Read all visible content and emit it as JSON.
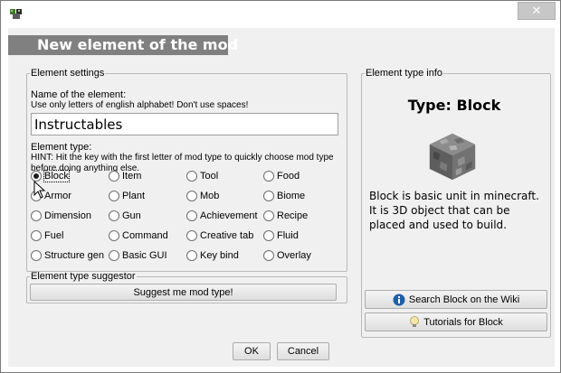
{
  "window": {
    "close_glyph": "✕"
  },
  "header": {
    "title": "New element of the mod"
  },
  "settings": {
    "legend": "Element settings",
    "name_label": "Name of the element:",
    "name_hint": "Use only letters of english alphabet! Don't use spaces!",
    "name_value": "Instructables",
    "type_label": "Element type:",
    "type_hint_1": "HINT: Hit the key with the first letter of mod type to quickly choose mod type",
    "type_hint_2": "before doing anything else.",
    "types": [
      [
        "Block",
        "Item",
        "Tool",
        "Food"
      ],
      [
        "Armor",
        "Plant",
        "Mob",
        "Biome"
      ],
      [
        "Dimension",
        "Gun",
        "Achievement",
        "Recipe"
      ],
      [
        "Fuel",
        "Command",
        "Creative tab",
        "Fluid"
      ],
      [
        "Structure gen",
        "Basic GUI",
        "Key bind",
        "Overlay"
      ]
    ],
    "selected": "Block"
  },
  "suggestor": {
    "legend": "Element type suggestor",
    "button": "Suggest me mod type!"
  },
  "info": {
    "legend": "Element type info",
    "title": "Type: Block",
    "description": "Block is basic unit in minecraft. It is 3D object that can be placed and used to build.",
    "wiki_button": "Search Block on the Wiki",
    "tutorial_button": "Tutorials for Block",
    "icons": {
      "wiki": "info-icon",
      "tutorial": "lightbulb-icon",
      "block": "cobblestone-block-icon"
    }
  },
  "footer": {
    "ok": "OK",
    "cancel": "Cancel"
  },
  "colors": {
    "header_bg": "#808080",
    "info_icon": "#1e5fa8"
  }
}
